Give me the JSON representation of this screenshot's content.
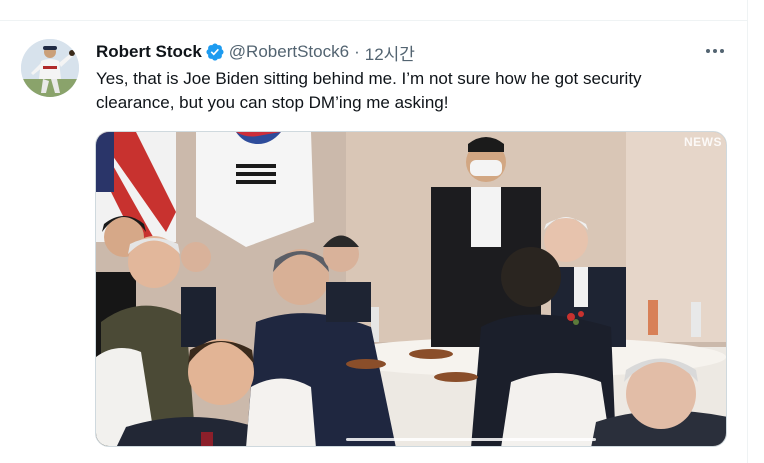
{
  "tweet": {
    "author": {
      "name": "Robert Stock",
      "handle": "@RobertStock6",
      "verified": true,
      "avatar_icon": "baseball-pitcher-avatar"
    },
    "separator": "·",
    "time": "12시간",
    "text": "Yes, that is Joe Biden sitting behind me. I’m not sure how he got security clearance, but you can stop DM’ing me asking!",
    "more_icon": "more-horizontal-icon",
    "media": {
      "type": "image",
      "watermark": "NEWS",
      "description_icon": "state-dinner-photo"
    }
  },
  "colors": {
    "text_primary": "#0f1419",
    "text_secondary": "#536471",
    "verified_blue": "#1d9bf0",
    "border": "#cfd9de"
  }
}
